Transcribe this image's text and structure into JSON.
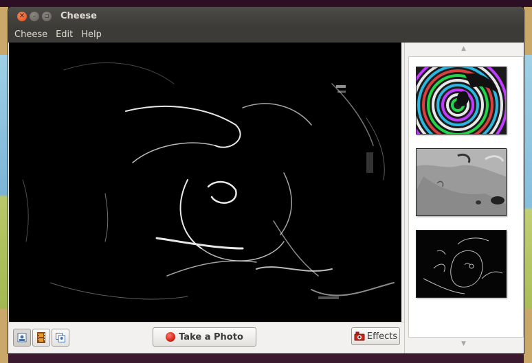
{
  "window": {
    "title": "Cheese"
  },
  "menu": [
    {
      "label": "Cheese"
    },
    {
      "label": "Edit"
    },
    {
      "label": "Help"
    }
  ],
  "toolbar": {
    "take_photo_label": "Take a Photo",
    "effects_label": "Effects"
  },
  "sidebar": {
    "scroll_up_icon": "triangle-up-icon",
    "scroll_down_icon": "triangle-down-icon"
  },
  "colors": {
    "titlebar": "#3c3b37",
    "close_button": "#de4a17",
    "record_red": "#cc1a10"
  }
}
